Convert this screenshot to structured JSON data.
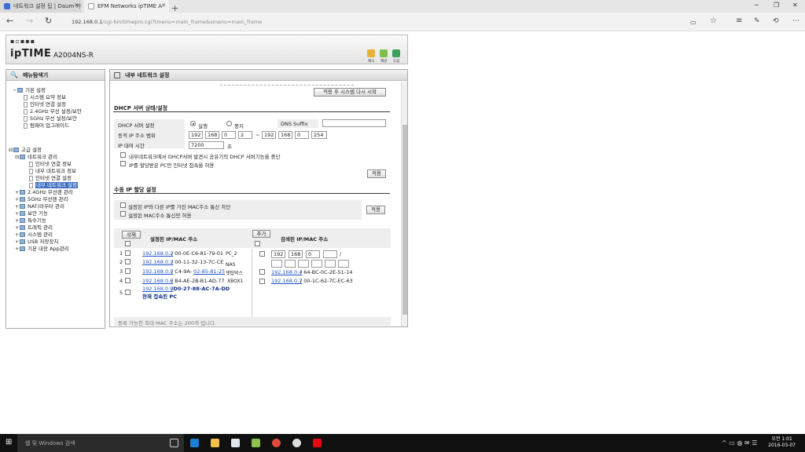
{
  "browser": {
    "tabs": [
      {
        "title": "네트워크 설정 팁 | Daum 카"
      },
      {
        "title": "EFM Networks ipTIME A"
      }
    ],
    "url_host": "192.168.0.1",
    "url_path": "/cgi-bin/timepro.cgi?tmenu=main_frame&smenu=main_frame"
  },
  "header": {
    "logo": "ipTIME",
    "model": "A2004NS-R",
    "icons": [
      {
        "label": "제시"
      },
      {
        "label": "제방"
      },
      {
        "label": "도움"
      }
    ]
  },
  "sidebar": {
    "title": "메뉴탐색기",
    "items": [
      {
        "label": "기본 설정"
      },
      {
        "label": "시스템 요약 정보"
      },
      {
        "label": "인터넷 연결 설정"
      },
      {
        "label": "2.4GHz 무선 설정/보안"
      },
      {
        "label": "5GHz 무선 설정/보안"
      },
      {
        "label": "펌웨어 업그레이드"
      },
      {
        "label": "고급 설정"
      },
      {
        "label": "네트워크 관리"
      },
      {
        "label": "인터넷 연결 정보"
      },
      {
        "label": "내부 네트워크 정보"
      },
      {
        "label": "인터넷 연결 설정"
      },
      {
        "label": "내부 네트워크 설정"
      },
      {
        "label": "2.4GHz 무선랜 관리"
      },
      {
        "label": "5GHz 무선랜 관리"
      },
      {
        "label": "NAT/라우터 관리"
      },
      {
        "label": "보안 기능"
      },
      {
        "label": "특수기능"
      },
      {
        "label": "트래픽 관리"
      },
      {
        "label": "시스템 관리"
      },
      {
        "label": "USB 저장장치"
      },
      {
        "label": "기본 내장 App관리"
      }
    ]
  },
  "content": {
    "title": "내부 네트워크 설정",
    "restart_button": "적용 후 시스템 다시 시작",
    "dhcp": {
      "section_title": "DHCP 서버 상태/설정",
      "server_label": "DHCP 서버 설정",
      "opt_on": "실행",
      "opt_off": "중지",
      "dns_label": "DNS Suffix",
      "dns_value": "",
      "range_label": "동적 IP 주소 범위",
      "range_start": [
        "192",
        "168",
        "0",
        "2"
      ],
      "range_sep": "~",
      "range_end": [
        "192",
        "168",
        "0",
        "254"
      ],
      "lease_label": "IP 대여 시간",
      "lease_value": "7200",
      "lease_unit": "초",
      "check1": "내부네트워크에서 DHCP서버 발견시 공유기의 DHCP 서버기능을 중단",
      "check2": "IP를 할당받은 PC만 인터넷 접속을 허용",
      "apply": "적용"
    },
    "manual": {
      "section_title": "수동 IP 할당 설정",
      "check1": "설정된 IP와 다른 IP를 가진 MAC주소 통신 차단",
      "check2": "설정된 MAC주소 통신만 허용",
      "apply": "적용",
      "delete_button": "삭제",
      "left_header": "설정된 IP/MAC 주소",
      "add_button": "추가",
      "right_header": "검색된 IP/MAC 주소",
      "rows": [
        {
          "num": "1",
          "ip": "192.168.0.2",
          "mac": "/ 00-0E-C6-81-79-01",
          "name": "PC_2"
        },
        {
          "num": "2",
          "ip": "192.168.0.3",
          "mac": "/ 00-11-32-13-7C-CE",
          "name": "NAS"
        },
        {
          "num": "3",
          "ip": "192.168.0.5",
          "mac": "/ C4-9A-",
          "mac_link": "02-85-81-25",
          "name": "셋탑박스"
        },
        {
          "num": "4",
          "ip": "192.168.0.6",
          "mac": "/ B4-AE-2B-B1-AD-77",
          "name": "XBOX1"
        },
        {
          "num": "5",
          "ip": "192.168.0.9",
          "mac": "/D0-27-88-AC-7A-DD",
          "name": "현재 접속된 PC"
        }
      ],
      "add_ip": [
        "192",
        "168",
        "0",
        ""
      ],
      "add_mac": [
        "",
        "",
        "",
        "",
        "",
        ""
      ],
      "add_sep": "/",
      "found": [
        {
          "ip": "192.168.0.4",
          "mac": "/ 64-BC-0C-2E-51-14"
        },
        {
          "ip": "192.168.0.7",
          "mac": "/ 00-1C-62-7C-EC-63"
        }
      ],
      "footer": "등록 가능한 최대 MAC 주소는 200개 입니다."
    }
  },
  "taskbar": {
    "search_placeholder": "웹 및 Windows 검색",
    "time": "오전 1:01",
    "date": "2016-03-07"
  }
}
